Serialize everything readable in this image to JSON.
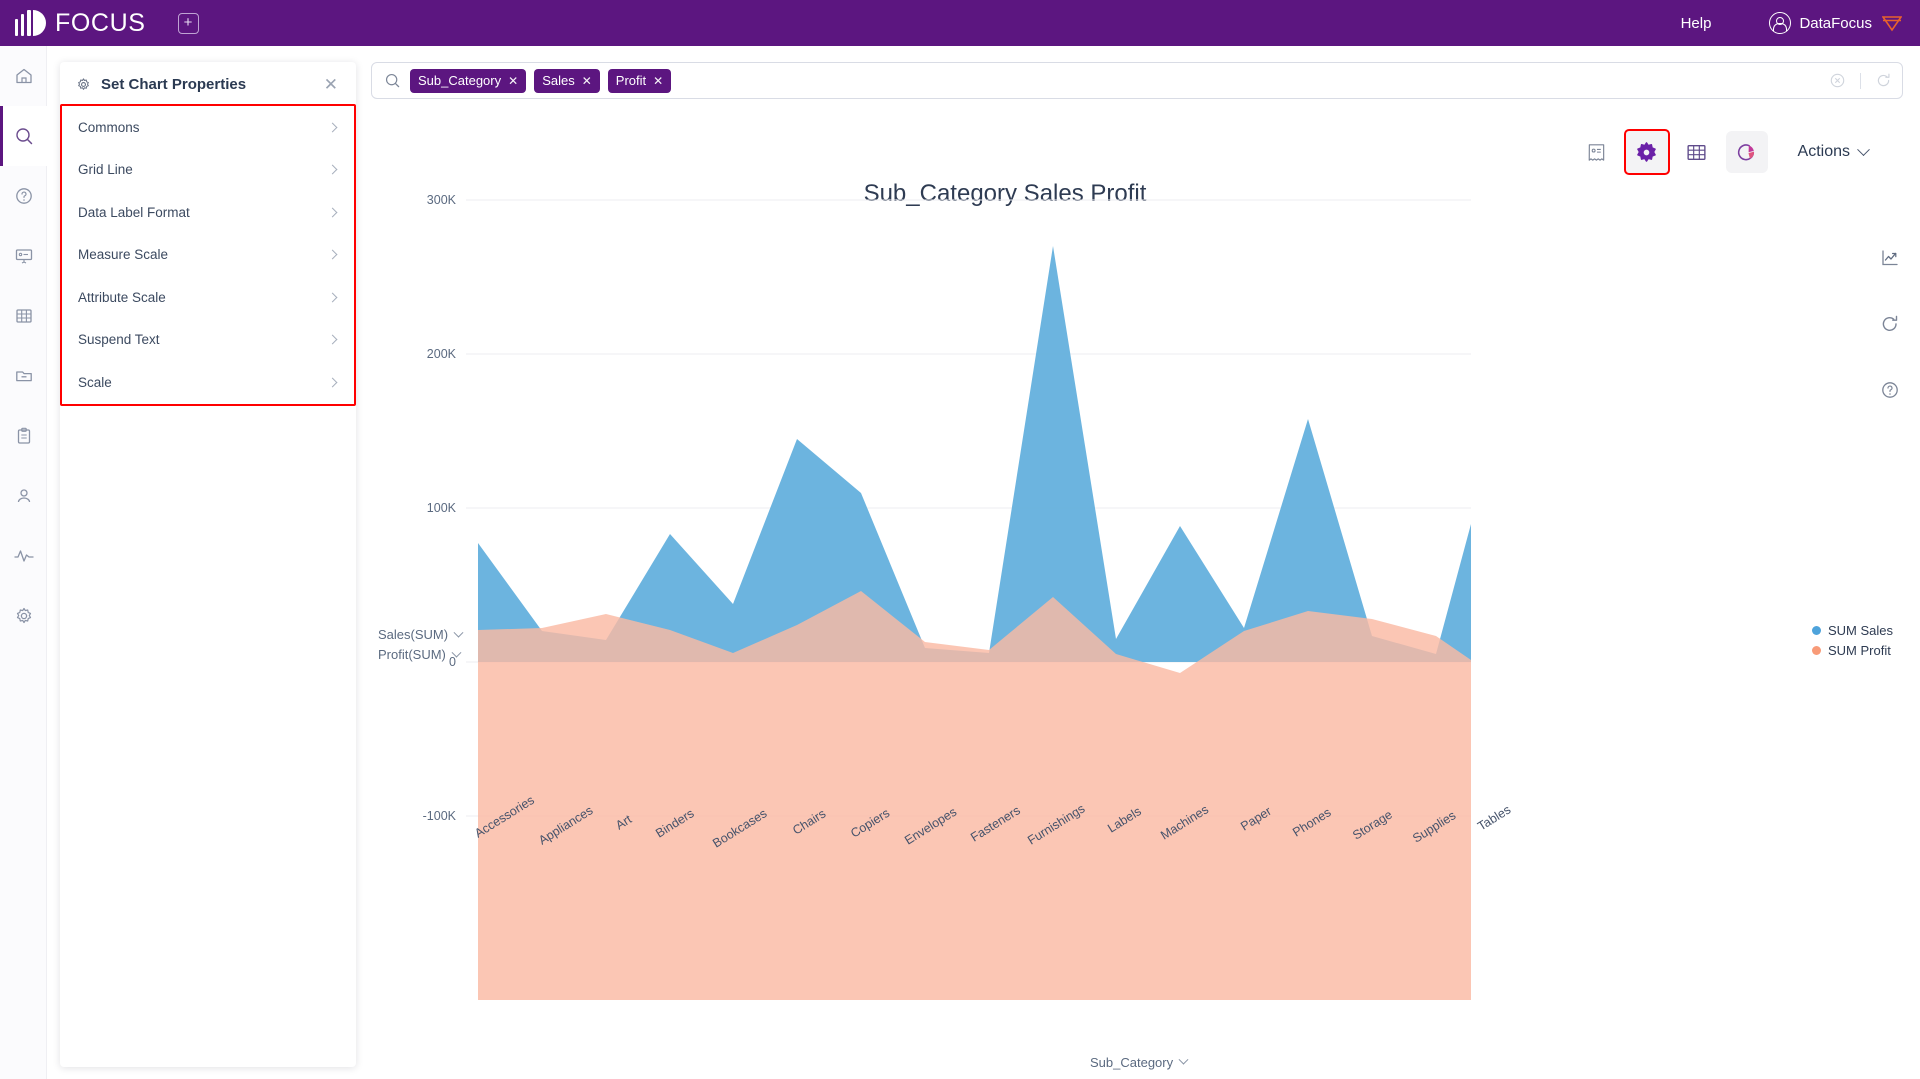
{
  "header": {
    "brand": "FOCUS",
    "add_tab_icon": "plus-square-icon",
    "help_label": "Help",
    "user_label": "DataFocus",
    "brand_color": "#5C1680"
  },
  "left_rail": {
    "items": [
      {
        "name": "home",
        "icon": "home-icon",
        "active": false
      },
      {
        "name": "search",
        "icon": "search-icon",
        "active": true
      },
      {
        "name": "help",
        "icon": "question-circle-icon",
        "active": false
      },
      {
        "name": "board",
        "icon": "presentation-icon",
        "active": false
      },
      {
        "name": "table",
        "icon": "table-grid-icon",
        "active": false
      },
      {
        "name": "folder",
        "icon": "folder-minus-icon",
        "active": false
      },
      {
        "name": "clipboard",
        "icon": "clipboard-icon",
        "active": false
      },
      {
        "name": "user",
        "icon": "user-icon",
        "active": false
      },
      {
        "name": "activity",
        "icon": "pulse-icon",
        "active": false
      },
      {
        "name": "settings",
        "icon": "gear-icon",
        "active": false
      }
    ]
  },
  "properties_panel": {
    "title": "Set Chart Properties",
    "title_icon": "gear-icon",
    "close_icon": "close-icon",
    "highlight_color": "#FF0000",
    "items": [
      {
        "label": "Commons"
      },
      {
        "label": "Grid Line"
      },
      {
        "label": "Data Label Format"
      },
      {
        "label": "Measure Scale"
      },
      {
        "label": "Attribute Scale"
      },
      {
        "label": "Suspend Text"
      },
      {
        "label": "Scale"
      }
    ]
  },
  "search": {
    "icon": "search-icon",
    "placeholder": "",
    "chips": [
      {
        "label": "Sub_Category"
      },
      {
        "label": "Sales"
      },
      {
        "label": "Profit"
      }
    ],
    "clear_icon": "clear-circle-icon",
    "reset_icon": "reset-icon"
  },
  "chart_toolbar": {
    "buttons": [
      {
        "name": "receipt-view",
        "icon": "receipt-icon",
        "selected": false,
        "filled": false
      },
      {
        "name": "chart-properties",
        "icon": "gear-icon",
        "selected": true,
        "filled": true
      },
      {
        "name": "table-view",
        "icon": "table-grid-icon",
        "selected": false,
        "filled": false
      },
      {
        "name": "chart-type",
        "icon": "pie-chart-icon",
        "selected": false,
        "filled": true
      }
    ],
    "actions_label": "Actions",
    "actions_chevron": "chevron-down-icon"
  },
  "right_rail": {
    "items": [
      {
        "name": "trend-chart",
        "icon": "trend-chart-icon"
      },
      {
        "name": "refresh",
        "icon": "refresh-icon"
      },
      {
        "name": "help",
        "icon": "question-circle-icon"
      }
    ]
  },
  "axis_controls": {
    "measures": [
      {
        "label": "Sales(SUM)"
      },
      {
        "label": "Profit(SUM)"
      }
    ],
    "attribute": {
      "label": "Sub_Category"
    }
  },
  "chart_data": {
    "type": "area",
    "title": "Sub_Category Sales Profit",
    "xlabel": "Sub_Category",
    "ylabel": "",
    "ylim": [
      -100000,
      300000
    ],
    "yticks": [
      300000,
      200000,
      100000,
      0,
      -100000
    ],
    "ytick_labels": [
      "300K",
      "200K",
      "100K",
      "0",
      "-100K"
    ],
    "grid": true,
    "legend_position": "right",
    "colors": {
      "sales": "#5FAEDC",
      "profit": "#F9B9A5",
      "overlap": "#C6A9A5"
    },
    "categories": [
      "Accessories",
      "Appliances",
      "Art",
      "Binders",
      "Bookcases",
      "Chairs",
      "Copiers",
      "Envelopes",
      "Fasteners",
      "Furnishings",
      "Labels",
      "Machines",
      "Paper",
      "Phones",
      "Storage",
      "Supplies",
      "Tables"
    ],
    "series": [
      {
        "name": "SUM Sales",
        "color": "#5FAEDC",
        "values": [
          77000,
          20000,
          14000,
          83000,
          38000,
          145000,
          110000,
          9000,
          6000,
          270000,
          15000,
          88000,
          22000,
          158000,
          17000,
          5000,
          85000
        ]
      },
      {
        "name": "SUM Profit",
        "color": "#F9B9A5",
        "values": [
          21000,
          22000,
          31000,
          21000,
          6000,
          24000,
          46000,
          13000,
          8000,
          42000,
          5000,
          -7000,
          20000,
          33000,
          28000,
          17000,
          1000
        ]
      }
    ]
  }
}
